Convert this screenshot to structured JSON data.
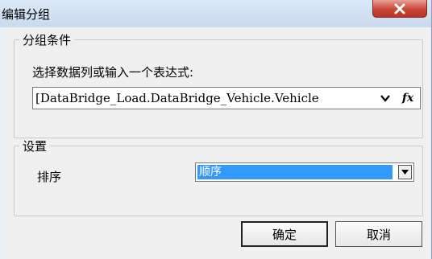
{
  "window": {
    "title": "编辑分组",
    "close_label": "X"
  },
  "group_condition": {
    "legend": "分组条件",
    "prompt": "选择数据列或输入一个表达式:",
    "expression_value": "[DataBridge_Load.DataBridge_Vehicle.Vehicle",
    "fx_label": "fx"
  },
  "settings": {
    "legend": "设置",
    "sort_label": "排序",
    "sort_value": "顺序"
  },
  "buttons": {
    "ok": "确定",
    "cancel": "取消"
  },
  "icons": {
    "close": "close-icon",
    "dropdown": "chevron-down-icon",
    "fx": "function-icon"
  }
}
